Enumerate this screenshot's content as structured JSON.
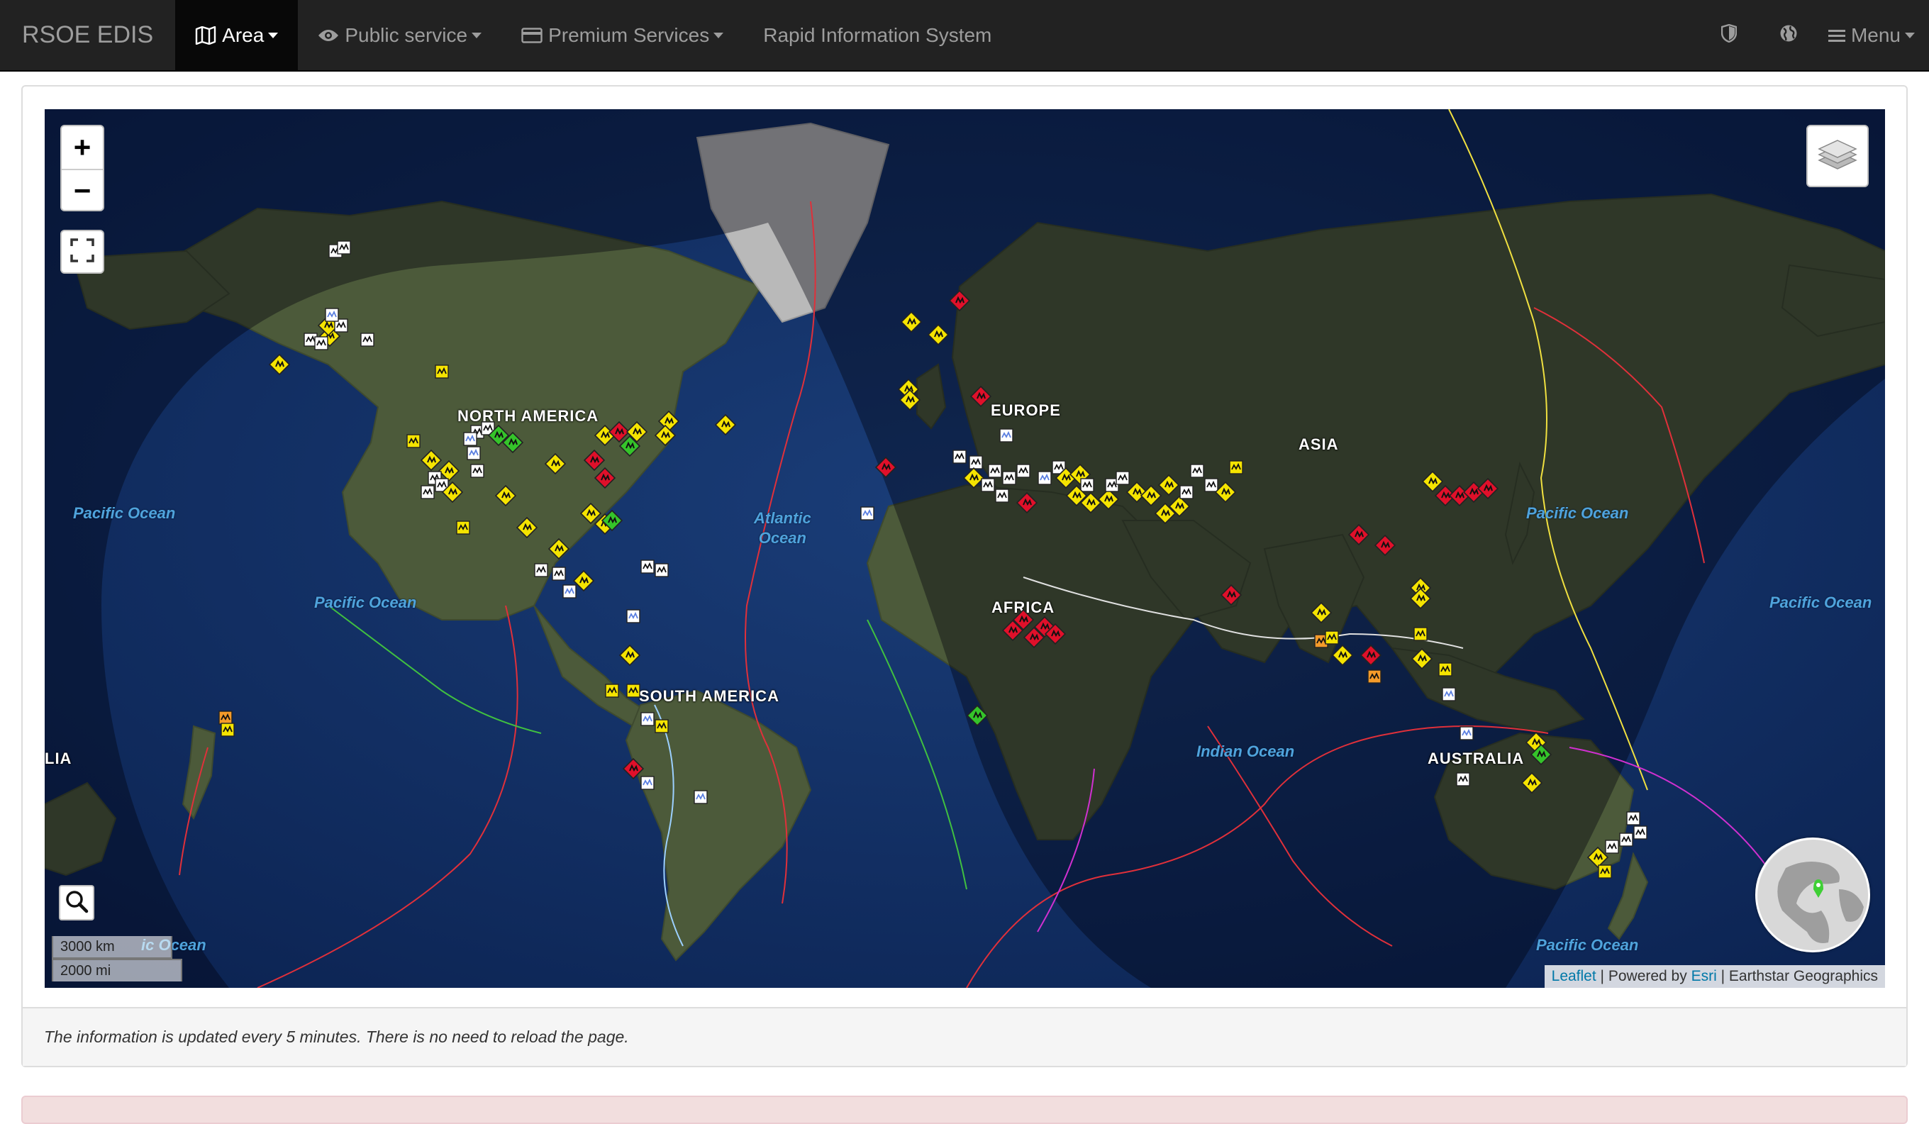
{
  "navbar": {
    "brand": "RSOE EDIS",
    "items": [
      {
        "label": "Area",
        "icon": "map-icon",
        "active": true,
        "dropdown": true
      },
      {
        "label": "Public service",
        "icon": "eye-icon",
        "active": false,
        "dropdown": true
      },
      {
        "label": "Premium Services",
        "icon": "credit-card-icon",
        "active": false,
        "dropdown": true
      },
      {
        "label": "Rapid Information System",
        "icon": "",
        "active": false,
        "dropdown": false
      }
    ],
    "right": {
      "shield_icon": "shield-icon",
      "globe_icon": "globe-icon",
      "menu_label": "Menu"
    }
  },
  "map": {
    "zoom_in": "+",
    "zoom_out": "−",
    "scale_km": "3000 km",
    "scale_mi": "2000 mi",
    "attribution": {
      "leaflet": "Leaflet",
      "powered": "| Powered by",
      "esri": "Esri",
      "rest": "| Earthstar Geographics"
    },
    "continents": [
      {
        "label": "NORTH AMERICA"
      },
      {
        "label": "EUROPE"
      },
      {
        "label": "ASIA"
      },
      {
        "label": "AFRICA"
      },
      {
        "label": "SOUTH AMERICA"
      },
      {
        "label": "AUSTRALIA"
      },
      {
        "label": "LIA"
      }
    ],
    "oceans": [
      {
        "label": "Pacific Ocean"
      },
      {
        "label": "Pacific Ocean"
      },
      {
        "label": "Atlantic\nOcean"
      },
      {
        "label": "Indian Ocean"
      },
      {
        "label": "Pacific Ocean"
      },
      {
        "label": "Pacific Ocean"
      },
      {
        "label": "Pacific Ocean"
      },
      {
        "label": "ic Ocean"
      }
    ],
    "marker_colors": {
      "yellow": "#f5e400",
      "red": "#e0102a",
      "green": "#35c42a",
      "white": "#ffffff",
      "blue": "#5b7fe0"
    }
  },
  "footer": {
    "note": "The information is updated every 5 minutes. There is no need to reload the page."
  }
}
